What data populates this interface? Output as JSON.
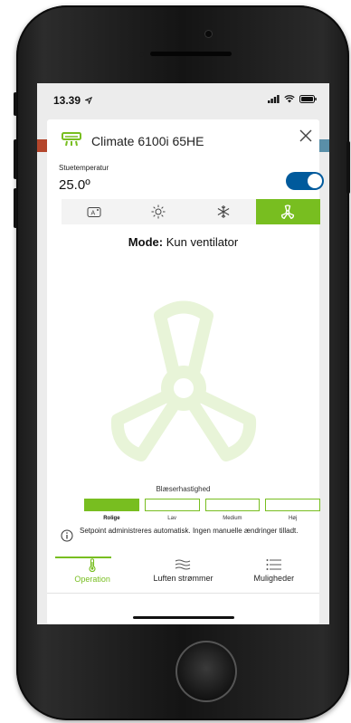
{
  "status_bar": {
    "time": "13.39"
  },
  "device": {
    "title": "Climate 6100i 65HE"
  },
  "temperature": {
    "label": "Stuetemperatur",
    "value": "25.0º"
  },
  "power": {
    "on": true
  },
  "mode_tabs": [
    {
      "name": "auto",
      "icon": "auto-mode-icon",
      "active": false
    },
    {
      "name": "heat",
      "icon": "sun-icon",
      "active": false
    },
    {
      "name": "cool",
      "icon": "snowflake-icon",
      "active": false
    },
    {
      "name": "fan",
      "icon": "fan-icon",
      "active": true
    }
  ],
  "mode": {
    "prefix": "Mode:",
    "name": "Kun ventilator"
  },
  "fan_speed": {
    "label": "Blæserhastighed",
    "options": [
      "Rolige",
      "Lav",
      "Medium",
      "Høj"
    ],
    "selected_index": 0
  },
  "info": {
    "text": "Setpoint administreres automatisk. Ingen manuelle ændringer tilladt."
  },
  "bottom_tabs": [
    {
      "label": "Operation",
      "icon": "thermometer-icon",
      "active": true
    },
    {
      "label": "Luften strømmer",
      "icon": "airflow-icon",
      "active": false
    },
    {
      "label": "Muligheder",
      "icon": "options-list-icon",
      "active": false
    }
  ],
  "colors": {
    "accent": "#78be20",
    "toggle": "#005a9c",
    "fan_watermark": "#e8f4d8"
  }
}
